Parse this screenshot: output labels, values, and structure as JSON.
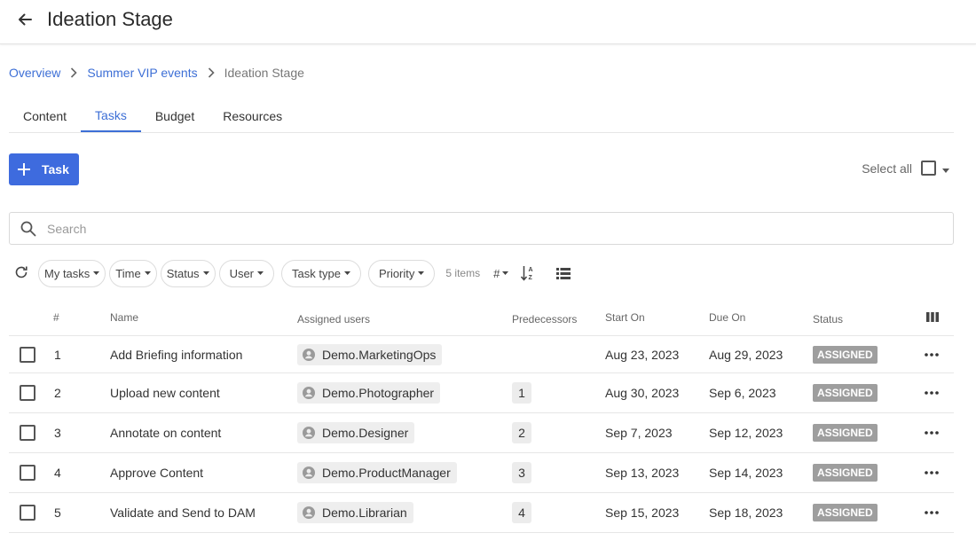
{
  "header": {
    "title": "Ideation Stage"
  },
  "breadcrumb": {
    "items": [
      "Overview",
      "Summer VIP events"
    ],
    "current": "Ideation Stage"
  },
  "tabs": [
    {
      "label": "Content",
      "active": false
    },
    {
      "label": "Tasks",
      "active": true
    },
    {
      "label": "Budget",
      "active": false
    },
    {
      "label": "Resources",
      "active": false
    }
  ],
  "toolbar": {
    "add_task_label": "Task",
    "select_all_label": "Select all"
  },
  "search": {
    "placeholder": "Search",
    "value": ""
  },
  "filters": {
    "chips": [
      "My tasks",
      "Time",
      "Status",
      "User",
      "Task type",
      "Priority"
    ],
    "items_count": "5 items",
    "sort_field": "#"
  },
  "table": {
    "columns": {
      "number": "#",
      "name": "Name",
      "assigned": "Assigned users",
      "predecessors": "Predecessors",
      "start": "Start On",
      "due": "Due On",
      "status": "Status"
    },
    "rows": [
      {
        "num": "1",
        "name": "Add Briefing information",
        "user": "Demo.MarketingOps",
        "pred": "",
        "start": "Aug 23, 2023",
        "due": "Aug 29, 2023",
        "status": "ASSIGNED"
      },
      {
        "num": "2",
        "name": "Upload new content",
        "user": "Demo.Photographer",
        "pred": "1",
        "start": "Aug 30, 2023",
        "due": "Sep 6, 2023",
        "status": "ASSIGNED"
      },
      {
        "num": "3",
        "name": "Annotate on content",
        "user": "Demo.Designer",
        "pred": "2",
        "start": "Sep 7, 2023",
        "due": "Sep 12, 2023",
        "status": "ASSIGNED"
      },
      {
        "num": "4",
        "name": "Approve Content",
        "user": "Demo.ProductManager",
        "pred": "3",
        "start": "Sep 13, 2023",
        "due": "Sep 14, 2023",
        "status": "ASSIGNED"
      },
      {
        "num": "5",
        "name": "Validate and Send to DAM",
        "user": "Demo.Librarian",
        "pred": "4",
        "start": "Sep 15, 2023",
        "due": "Sep 18, 2023",
        "status": "ASSIGNED"
      }
    ]
  },
  "colors": {
    "accent": "#3e6bde",
    "link": "#3d6fd6",
    "status_badge": "#9e9e9e"
  }
}
